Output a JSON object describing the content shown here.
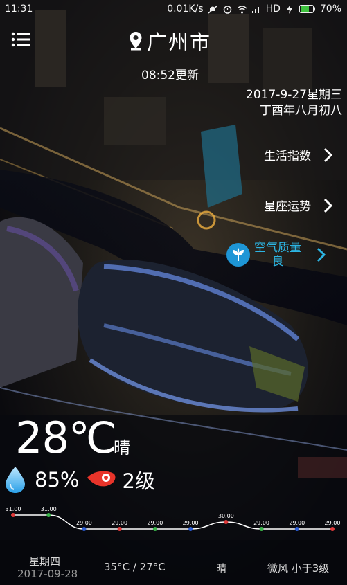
{
  "status_bar": {
    "time": "11:31",
    "net_speed": "0.01K/s",
    "network": "HD",
    "battery": "70%"
  },
  "header": {
    "city": "广州市",
    "updated": "08:52更新"
  },
  "date": {
    "gregorian": "2017-9-27星期三",
    "lunar": "丁酉年八月初八"
  },
  "side_menu": {
    "life_index": "生活指数",
    "horoscope": "星座运势",
    "air_quality_label": "空气质量",
    "air_quality_value": "良"
  },
  "current": {
    "temperature": "28℃",
    "condition": "晴",
    "humidity": "85%",
    "wind_level": "2级"
  },
  "chart_data": {
    "type": "line",
    "values": [
      31.0,
      31.0,
      29.0,
      29.0,
      29.0,
      29.0,
      30.0,
      29.0,
      29.0,
      29.0
    ],
    "labels": [
      "31.00",
      "31.00",
      "29.00",
      "29.00",
      "29.00",
      "29.00",
      "30.00",
      "29.00",
      "29.00",
      "29.00"
    ],
    "point_colors": [
      "#e03a3a",
      "#3ab54a",
      "#2d5fd6",
      "#e03a3a",
      "#3ab54a",
      "#2d5fd6",
      "#e03a3a",
      "#3ab54a",
      "#2d5fd6",
      "#e03a3a"
    ]
  },
  "forecast": {
    "day": "星期四",
    "date": "2017-09-28",
    "temp_range": "35°C / 27°C",
    "condition": "晴",
    "wind": "微风 小于3级"
  }
}
